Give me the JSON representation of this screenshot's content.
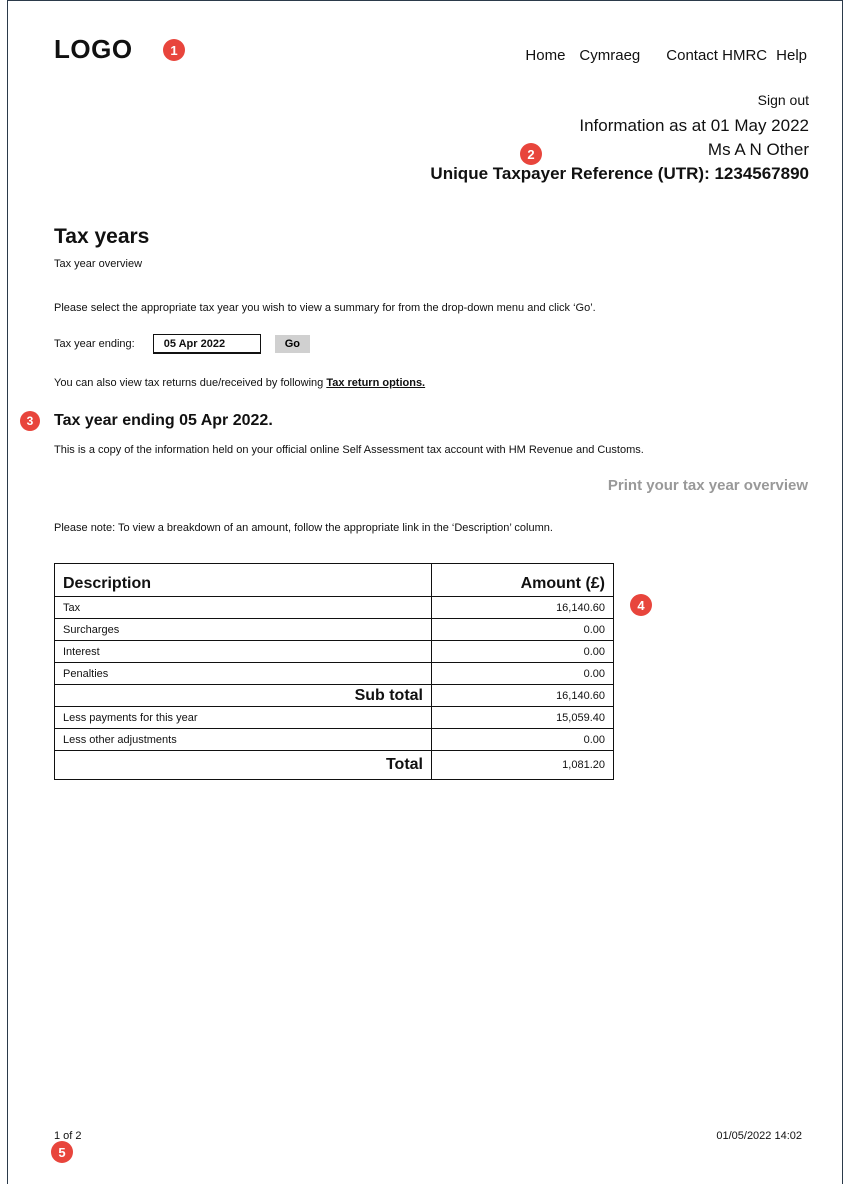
{
  "header": {
    "logo_text": "LOGO",
    "nav": {
      "home": "Home",
      "cymraeg": "Cymraeg",
      "contact": "Contact HMRC",
      "help": "Help"
    },
    "sign_out": "Sign out",
    "info_date": "Information as at 01 May 2022",
    "taxpayer_name": "Ms A N Other",
    "utr": "Unique Taxpayer Reference (UTR): 1234567890"
  },
  "markers": [
    "1",
    "2",
    "3",
    "4",
    "5"
  ],
  "main": {
    "title": "Tax years",
    "subtitle": "Tax year overview",
    "instruction": "Please select the appropriate tax year you wish to view a summary for from the drop-down menu and click ‘Go’.",
    "selector": {
      "label": "Tax year ending:",
      "selected_value": "05 Apr 2022",
      "go_label": "Go"
    },
    "also_text": "You can also view tax returns due/received by following ",
    "also_link": "Tax return options.",
    "year_heading": "Tax year ending 05 Apr 2022.",
    "copy_text": "This is a copy of the information held on your official online Self Assessment tax account with HM Revenue and Customs.",
    "print_link": "Print your tax year overview",
    "note_text": "Please note: To view a breakdown of an amount, follow the appropriate link in the ‘Description’ column."
  },
  "table": {
    "headers": [
      "Description",
      "Amount (£)"
    ],
    "rows": [
      {
        "description": "Tax",
        "amount": "16,140.60"
      },
      {
        "description": "Surcharges",
        "amount": "0.00"
      },
      {
        "description": "Interest",
        "amount": "0.00"
      },
      {
        "description": "Penalties",
        "amount": "0.00"
      }
    ],
    "subtotal": {
      "label": "Sub total",
      "amount": "16,140.60"
    },
    "rows2": [
      {
        "description": "Less payments for this year",
        "amount": "15,059.40"
      },
      {
        "description": "Less other adjustments",
        "amount": "0.00"
      }
    ],
    "total": {
      "label": "Total",
      "amount": "1,081.20"
    }
  },
  "footer": {
    "page_count": "1 of 2",
    "timestamp": "01/05/2022 14:02"
  },
  "colors": {
    "marker": "#e8453c",
    "button": "#d0d0d0",
    "print_link": "#999999"
  }
}
